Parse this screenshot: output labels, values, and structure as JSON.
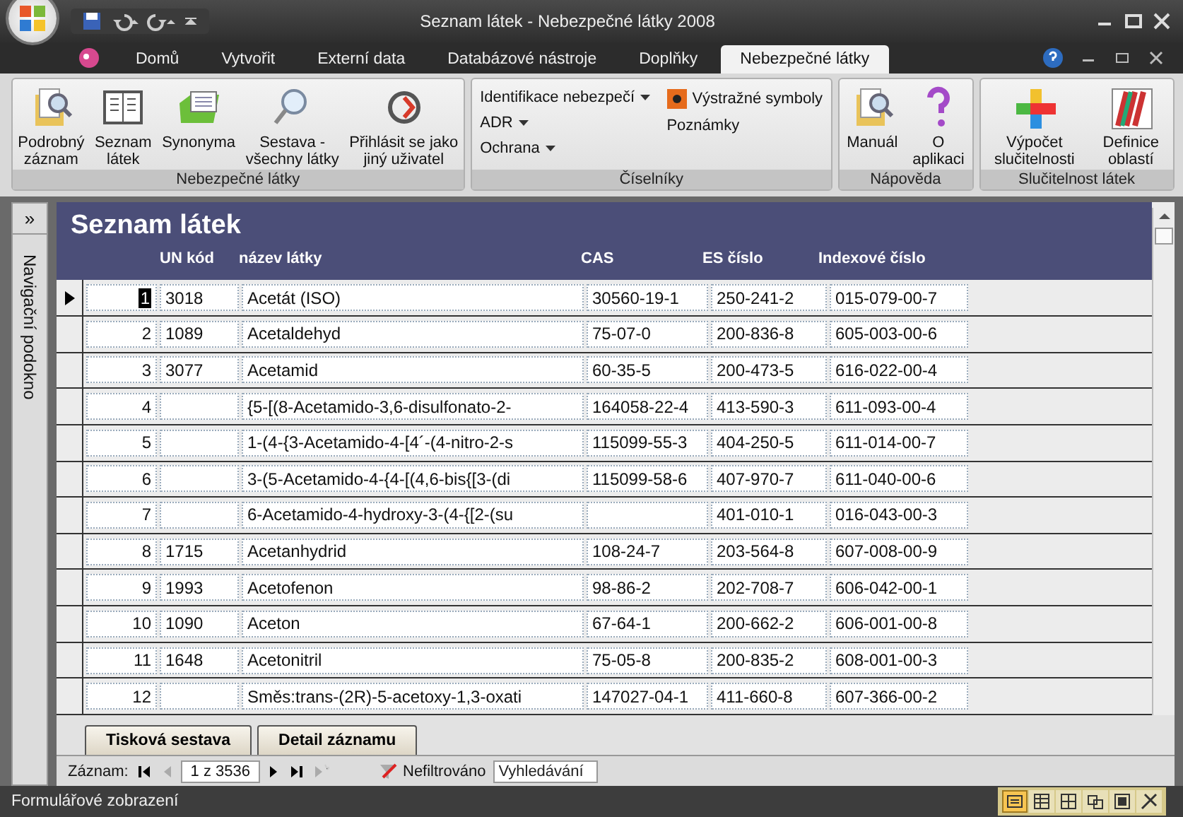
{
  "title_bar": {
    "title": "Seznam látek - Nebezpečné látky 2008"
  },
  "ribbon_tabs": [
    {
      "label": "Domů",
      "selected": false
    },
    {
      "label": "Vytvořit",
      "selected": false
    },
    {
      "label": "Externí data",
      "selected": false
    },
    {
      "label": "Databázové nástroje",
      "selected": false
    },
    {
      "label": "Doplňky",
      "selected": false
    },
    {
      "label": "Nebezpečné látky",
      "selected": true
    }
  ],
  "ribbon_groups": [
    {
      "title": "Nebezpečné látky",
      "items": [
        {
          "kind": "large",
          "label": "Podrobný\nzáznam"
        },
        {
          "kind": "large",
          "label": "Seznam\nlátek"
        },
        {
          "kind": "large",
          "label": "Synonyma"
        },
        {
          "kind": "large",
          "label": "Sestava -\nvšechny látky"
        },
        {
          "kind": "large",
          "label": "Přihlásit se jako\njiný uživatel"
        }
      ]
    },
    {
      "title": "Číselníky",
      "items": [
        {
          "kind": "small",
          "label": "Identifikace nebezpečí",
          "dropdown": true
        },
        {
          "kind": "small",
          "label": "ADR",
          "dropdown": true
        },
        {
          "kind": "small",
          "label": "Ochrana",
          "dropdown": true
        },
        {
          "kind": "small",
          "label": "Výstražné symboly",
          "dropdown": false
        },
        {
          "kind": "small",
          "label": "Poznámky",
          "dropdown": false
        }
      ]
    },
    {
      "title": "Nápověda",
      "items": [
        {
          "kind": "large",
          "label": "Manuál"
        },
        {
          "kind": "large",
          "label": "O\naplikaci"
        }
      ]
    },
    {
      "title": "Slučitelnost látek",
      "items": [
        {
          "kind": "large",
          "label": "Výpočet\nslučitelnosti"
        },
        {
          "kind": "large",
          "label": "Definice\noblastí"
        }
      ]
    }
  ],
  "nav_pane": {
    "label": "Navigační podokno",
    "toggle": "»"
  },
  "form": {
    "title": "Seznam látek",
    "columns": [
      "",
      "UN kód",
      "název látky",
      "CAS",
      "ES číslo",
      "Indexové číslo"
    ],
    "rows": [
      {
        "current": true,
        "cells": [
          "1",
          "3018",
          "Acetát (ISO)",
          "30560-19-1",
          "250-241-2",
          "015-079-00-7"
        ]
      },
      {
        "current": false,
        "cells": [
          "2",
          "1089",
          "Acetaldehyd",
          "75-07-0",
          "200-836-8",
          "605-003-00-6"
        ]
      },
      {
        "current": false,
        "cells": [
          "3",
          "3077",
          "Acetamid",
          "60-35-5",
          "200-473-5",
          "616-022-00-4"
        ]
      },
      {
        "current": false,
        "cells": [
          "4",
          null,
          "{5-[(8-Acetamido-3,6-disulfonato-2-",
          "164058-22-4",
          "413-590-3",
          "611-093-00-4"
        ]
      },
      {
        "current": false,
        "cells": [
          "5",
          null,
          "1-(4-{3-Acetamido-4-[4´-(4-nitro-2-s",
          "115099-55-3",
          "404-250-5",
          "611-014-00-7"
        ]
      },
      {
        "current": false,
        "cells": [
          "6",
          null,
          "3-(5-Acetamido-4-{4-[(4,6-bis{[3-(di",
          "115099-58-6",
          "407-970-7",
          "611-040-00-6"
        ]
      },
      {
        "current": false,
        "cells": [
          "7",
          null,
          "6-Acetamido-4-hydroxy-3-(4-{[2-(su",
          null,
          "401-010-1",
          "016-043-00-3"
        ]
      },
      {
        "current": false,
        "cells": [
          "8",
          "1715",
          "Acetanhydrid",
          "108-24-7",
          "203-564-8",
          "607-008-00-9"
        ]
      },
      {
        "current": false,
        "cells": [
          "9",
          "1993",
          "Acetofenon",
          "98-86-2",
          "202-708-7",
          "606-042-00-1"
        ]
      },
      {
        "current": false,
        "cells": [
          "10",
          "1090",
          "Aceton",
          "67-64-1",
          "200-662-2",
          "606-001-00-8"
        ]
      },
      {
        "current": false,
        "cells": [
          "11",
          "1648",
          "Acetonitril",
          "75-05-8",
          "200-835-2",
          "608-001-00-3"
        ]
      },
      {
        "current": false,
        "cells": [
          "12",
          null,
          "Směs:trans-(2R)-5-acetoxy-1,3-oxati",
          "147027-04-1",
          "411-660-8",
          "607-366-00-2"
        ]
      }
    ],
    "buttons": [
      "Tisková sestava",
      "Detail záznamu"
    ]
  },
  "record_nav": {
    "label": "Záznam:",
    "position": "1 z 3536",
    "filter": "Nefiltrováno",
    "search": {
      "placeholder": "Vyhledávání"
    }
  },
  "status_bar": {
    "text": "Formulářové zobrazení",
    "views": [
      {
        "selected": true
      },
      {
        "selected": false
      },
      {
        "selected": false
      },
      {
        "selected": false
      },
      {
        "selected": false
      },
      {
        "selected": false
      }
    ]
  }
}
